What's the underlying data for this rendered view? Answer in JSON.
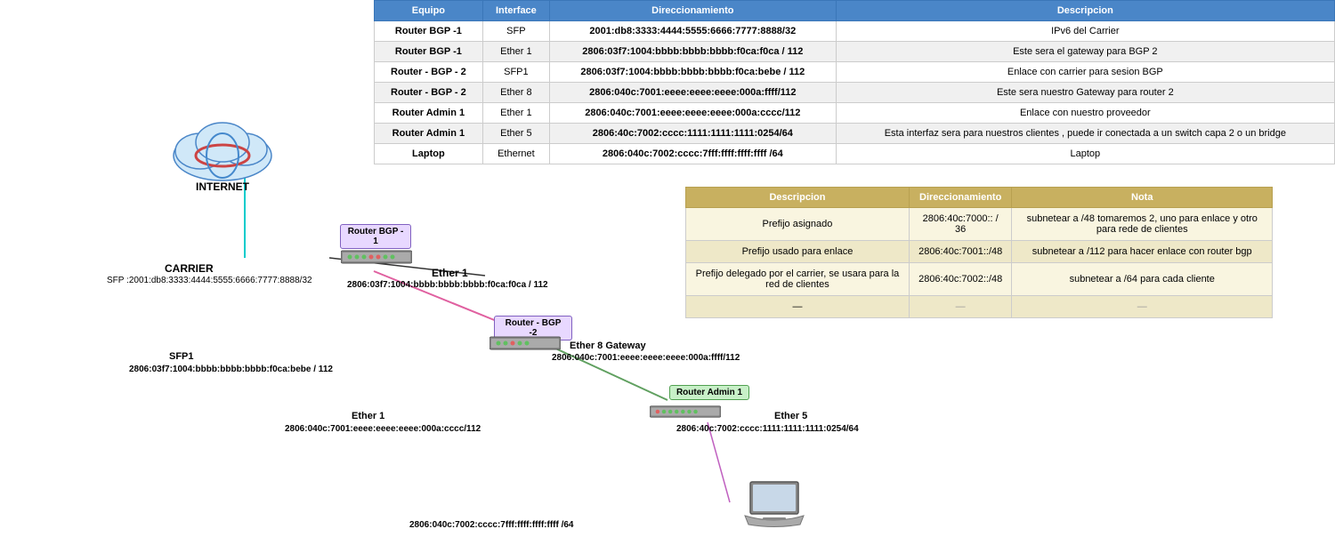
{
  "table": {
    "headers": [
      "Equipo",
      "Interface",
      "Direccionamiento",
      "Descripcion"
    ],
    "rows": [
      {
        "equipo": "Router BGP -1",
        "interface": "SFP",
        "direccionamiento": "2001:db8:3333:4444:5555:6666:7777:8888/32",
        "descripcion": "IPv6 del Carrier"
      },
      {
        "equipo": "Router BGP -1",
        "interface": "Ether 1",
        "direccionamiento": "2806:03f7:1004:bbbb:bbbb:bbbb:f0ca:f0ca / 112",
        "descripcion": "Este sera el gateway para BGP 2"
      },
      {
        "equipo": "Router - BGP - 2",
        "interface": "SFP1",
        "direccionamiento": "2806:03f7:1004:bbbb:bbbb:bbbb:f0ca:bebe / 112",
        "descripcion": "Enlace con carrier para sesion BGP"
      },
      {
        "equipo": "Router - BGP - 2",
        "interface": "Ether 8",
        "direccionamiento": "2806:040c:7001:eeee:eeee:eeee:000a:ffff/112",
        "descripcion": "Este sera nuestro Gateway para router 2"
      },
      {
        "equipo": "Router Admin 1",
        "interface": "Ether 1",
        "direccionamiento": "2806:040c:7001:eeee:eeee:eeee:000a:cccc/112",
        "descripcion": "Enlace con nuestro proveedor"
      },
      {
        "equipo": "Router Admin 1",
        "interface": "Ether 5",
        "direccionamiento": "2806:40c:7002:cccc:1111:1111:1111:0254/64",
        "descripcion": "Esta interfaz sera para nuestros clientes , puede ir conectada a un switch capa 2 o un bridge"
      },
      {
        "equipo": "Laptop",
        "interface": "Ethernet",
        "direccionamiento": "2806:040c:7002:cccc:7fff:ffff:ffff:ffff /64",
        "descripcion": "Laptop"
      }
    ]
  },
  "table2": {
    "headers": [
      "Descripcion",
      "Direccionamiento",
      "Nota"
    ],
    "rows": [
      {
        "desc": "Prefijo asignado",
        "dir": "2806:40c:7000:: / 36",
        "nota": "subnetear a /48  tomaremos 2, uno para enlace y otro para rede de clientes"
      },
      {
        "desc": "Prefijo usado para enlace",
        "dir": "2806:40c:7001::/48",
        "nota": "subnetear a /112 para hacer enlace con router bgp"
      },
      {
        "desc": "Prefijo delegado por el carrier, se usara para la red de clientes",
        "dir": "2806:40c:7002::/48",
        "nota": "subnetear a /64 para cada cliente"
      },
      {
        "desc": "—",
        "dir": "—",
        "nota": "—"
      }
    ]
  },
  "diagram": {
    "internet_label": "INTERNET",
    "carrier_label": "CARRIER",
    "carrier_sfp": "SFP :2001:db8:3333:4444:5555:6666:7777:8888/32",
    "router_bgp1_label": "Router BGP -\n1",
    "ether1_bgp1_label": "Ether 1",
    "ether1_bgp1_addr": "2806:03f7:1004:bbbb:bbbb:bbbb:f0ca:f0ca / 112",
    "router_bgp2_label": "Router - BGP -2",
    "sfp1_bgp2_label": "SFP1",
    "sfp1_bgp2_addr": "2806:03f7:1004:bbbb:bbbb:bbbb:f0ca:bebe / 112",
    "ether8_label": "Ether 8 Gateway",
    "ether8_addr": "2806:040c:7001:eeee:eeee:eeee:000a:ffff/112",
    "router_admin1_label": "Router Admin 1",
    "ether1_admin_label": "Ether 1",
    "ether1_admin_addr": "2806:040c:7001:eeee:eeee:eeee:000a:cccc/112",
    "ether5_label": "Ether 5",
    "ether5_addr": "2806:40c:7002:cccc:1111:1111:1111:0254/64",
    "laptop_label": "2806:040c:7002:cccc:7fff:ffff:ffff:ffff /64"
  }
}
